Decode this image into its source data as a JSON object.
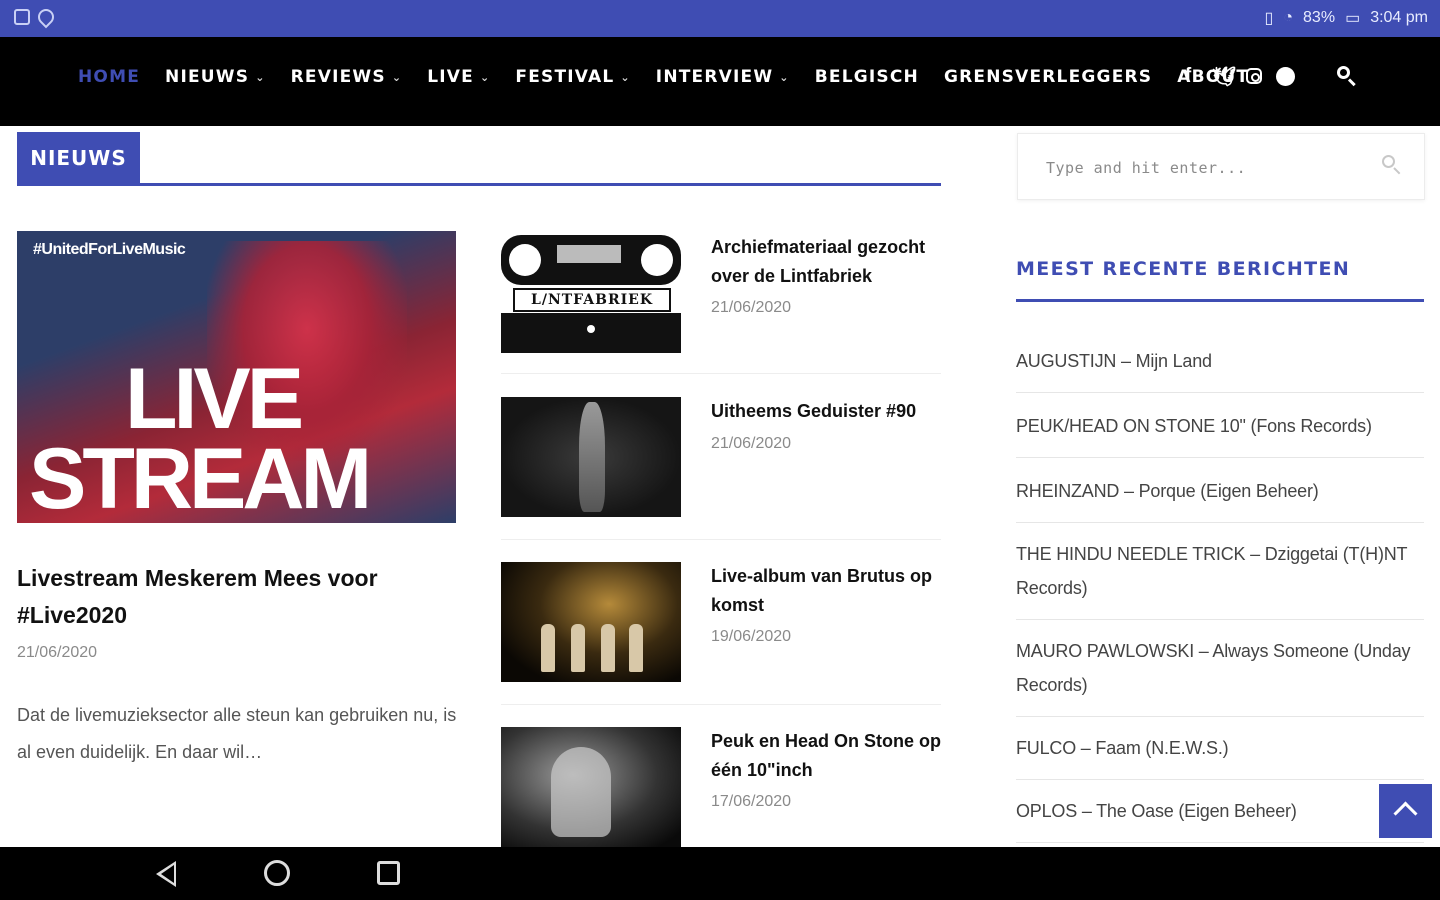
{
  "status_bar": {
    "battery": "83%",
    "time": "3:04 pm"
  },
  "nav": {
    "items": [
      {
        "label": "HOME",
        "active": true,
        "has_dropdown": false
      },
      {
        "label": "NIEUWS",
        "active": false,
        "has_dropdown": true
      },
      {
        "label": "REVIEWS",
        "active": false,
        "has_dropdown": true
      },
      {
        "label": "LIVE",
        "active": false,
        "has_dropdown": true
      },
      {
        "label": "FESTIVAL",
        "active": false,
        "has_dropdown": true
      },
      {
        "label": "INTERVIEW",
        "active": false,
        "has_dropdown": true
      },
      {
        "label": "BELGISCH",
        "active": false,
        "has_dropdown": false
      },
      {
        "label": "GRENSVERLEGGERS",
        "active": false,
        "has_dropdown": false
      },
      {
        "label": "ABOUT",
        "active": false,
        "has_dropdown": false
      }
    ],
    "social_icons": [
      "facebook-icon",
      "twitter-icon",
      "instagram-icon",
      "spotify-icon"
    ],
    "search_icon": "search-icon"
  },
  "section": {
    "label": "NIEUWS"
  },
  "featured": {
    "image_text": {
      "hashtag": "#UnitedForLiveMusic",
      "line1": "LIVE",
      "line2": "STREAM"
    },
    "title": "Livestream Meskerem Mees voor #Live2020",
    "date": "21/06/2020",
    "excerpt": "Dat de livemuzieksector alle steun kan gebruiken nu, is al even duidelijk. En daar wil…"
  },
  "posts": [
    {
      "title": "Archiefmateriaal gezocht over de Lintfabriek",
      "date": "21/06/2020",
      "thumb_text": "L/NTFABRIEK"
    },
    {
      "title": "Uitheems Geduister #90",
      "date": "21/06/2020"
    },
    {
      "title": "Live-album van Brutus op komst",
      "date": "19/06/2020"
    },
    {
      "title": "Peuk en Head On Stone op één 10\"inch",
      "date": "17/06/2020"
    }
  ],
  "sidebar": {
    "search_placeholder": "Type and hit enter...",
    "widget_title": "MEEST RECENTE BERICHTEN",
    "recent": [
      "AUGUSTIJN – Mijn Land",
      "PEUK/HEAD ON STONE 10\" (Fons Records)",
      "RHEINZAND – Porque (Eigen Beheer)",
      "THE HINDU NEEDLE TRICK – Dziggetai (T(H)NT Records)",
      "MAURO PAWLOWSKI – Always Someone (Unday Records)",
      "FULCO – Faam (N.E.W.S.)",
      "OPLOS – The Oase (Eigen Beheer)"
    ]
  },
  "colors": {
    "accent": "#3f4db3",
    "nav_bg": "#000000",
    "meta_text": "#8a8a8a"
  }
}
